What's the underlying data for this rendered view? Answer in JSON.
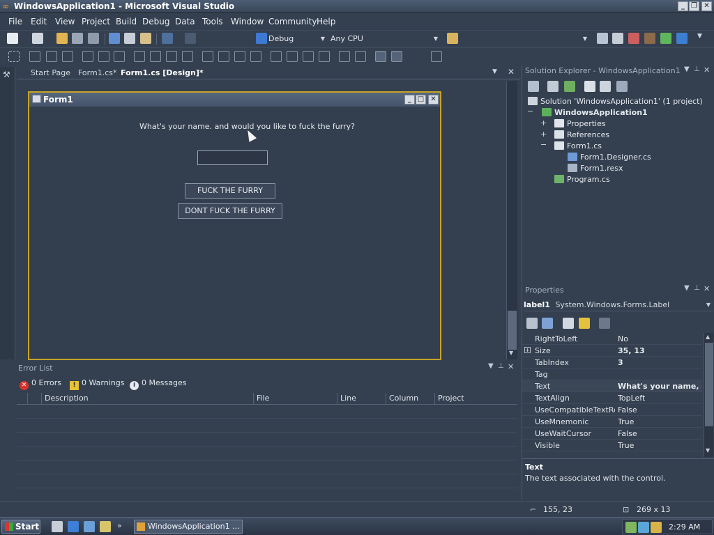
{
  "window": {
    "title": "WindowsApplication1 - Microsoft Visual Studio",
    "controls": [
      "_",
      "❐",
      "✕"
    ]
  },
  "menu": [
    "File",
    "Edit",
    "View",
    "Project",
    "Build",
    "Debug",
    "Data",
    "Tools",
    "Window",
    "Community",
    "Help"
  ],
  "toolbar": {
    "config": "Debug",
    "platform": "Any CPU"
  },
  "doc_tabs": [
    "Start Page",
    "Form1.cs*",
    "Form1.cs [Design]*"
  ],
  "form": {
    "title": "Form1",
    "label": "What's your name. and would you like to fuck the furry?",
    "button1": "FUCK THE FURRY",
    "button2": "DONT FUCK THE FURRY"
  },
  "error_list": {
    "title": "Error List",
    "errors": "0 Errors",
    "warnings": "0 Warnings",
    "messages": "0 Messages",
    "columns": [
      "Description",
      "File",
      "Line",
      "Column",
      "Project"
    ]
  },
  "solution_explorer": {
    "title": "Solution Explorer - WindowsApplication1",
    "items": [
      "Solution 'WindowsApplication1' (1 project)",
      "WindowsApplication1",
      "Properties",
      "References",
      "Form1.cs",
      "Form1.Designer.cs",
      "Form1.resx",
      "Program.cs"
    ],
    "expanders": [
      "−",
      "+",
      "+",
      "−"
    ]
  },
  "properties": {
    "title": "Properties",
    "object_name": "label1",
    "object_type": "System.Windows.Forms.Label",
    "rows": [
      {
        "name": "RightToLeft",
        "value": "No"
      },
      {
        "name": "Size",
        "value": "35, 13"
      },
      {
        "name": "TabIndex",
        "value": "3"
      },
      {
        "name": "Tag",
        "value": ""
      },
      {
        "name": "Text",
        "value": "What's your name, an"
      },
      {
        "name": "TextAlign",
        "value": "TopLeft"
      },
      {
        "name": "UseCompatibleTextRendering",
        "value": "False"
      },
      {
        "name": "UseMnemonic",
        "value": "True"
      },
      {
        "name": "UseWaitCursor",
        "value": "False"
      },
      {
        "name": "Visible",
        "value": "True"
      }
    ],
    "desc_title": "Text",
    "desc_text": "The text associated with the control."
  },
  "status": {
    "position": "155, 23",
    "size": "269 x 13"
  },
  "taskbar": {
    "start": "Start",
    "task": "WindowsApplication1 ...",
    "clock": "2:29 AM"
  }
}
